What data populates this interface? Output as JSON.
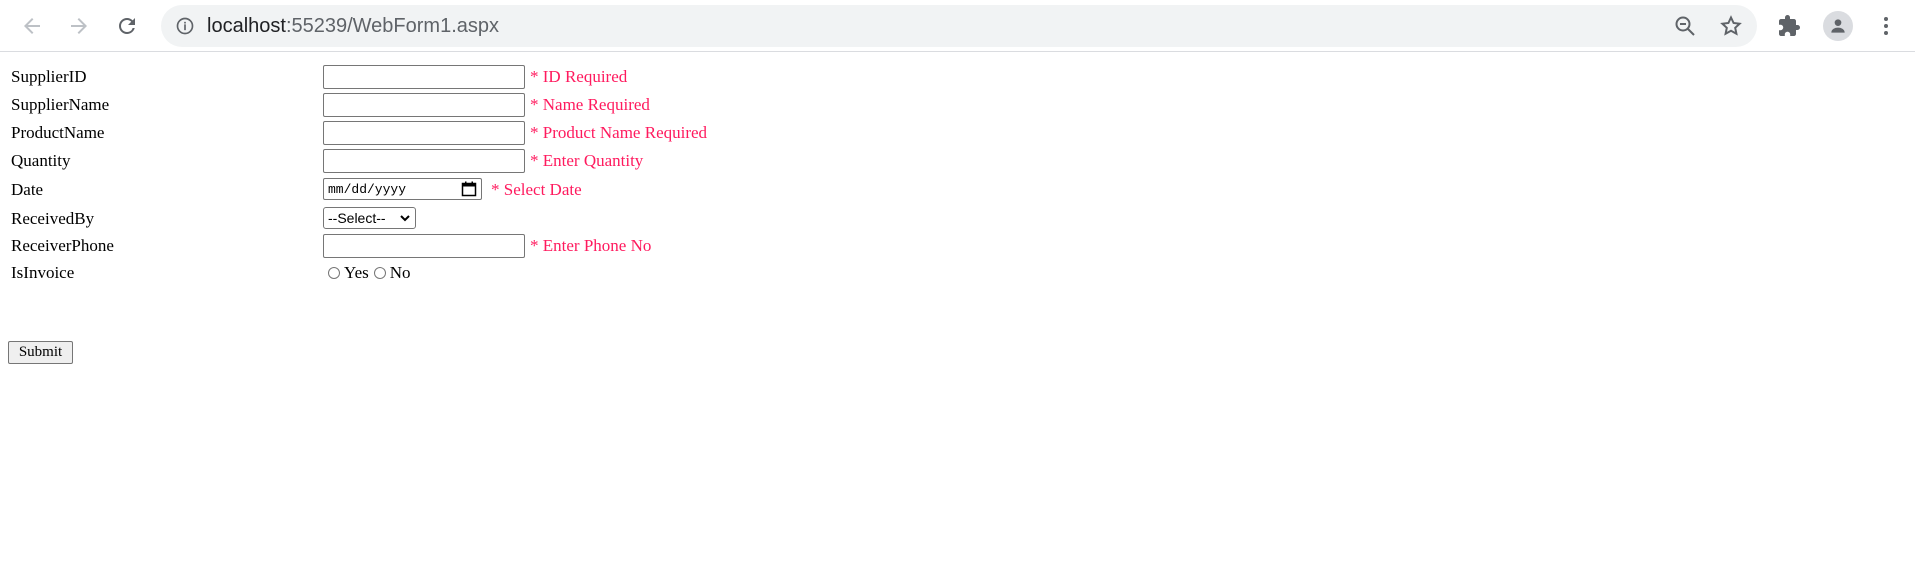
{
  "browser": {
    "url_host": "localhost",
    "url_path": ":55239/WebForm1.aspx"
  },
  "form": {
    "supplier_id": {
      "label": "SupplierID",
      "value": "",
      "validator": "* ID Required"
    },
    "supplier_name": {
      "label": "SupplierName",
      "value": "",
      "validator": "* Name Required"
    },
    "product_name": {
      "label": "ProductName",
      "value": "",
      "validator": "* Product Name Required"
    },
    "quantity": {
      "label": "Quantity",
      "value": "",
      "validator": "* Enter Quantity"
    },
    "date": {
      "label": "Date",
      "placeholder": "mm/dd/yyyy",
      "validator": "* Select Date"
    },
    "received_by": {
      "label": "ReceivedBy",
      "selected": "--Select--"
    },
    "receiver_phone": {
      "label": "ReceiverPhone",
      "value": "",
      "validator": "* Enter Phone No"
    },
    "is_invoice": {
      "label": "IsInvoice",
      "options": [
        "Yes",
        "No"
      ]
    },
    "submit_label": "Submit"
  },
  "colors": {
    "validator": "#ff1a5e"
  }
}
